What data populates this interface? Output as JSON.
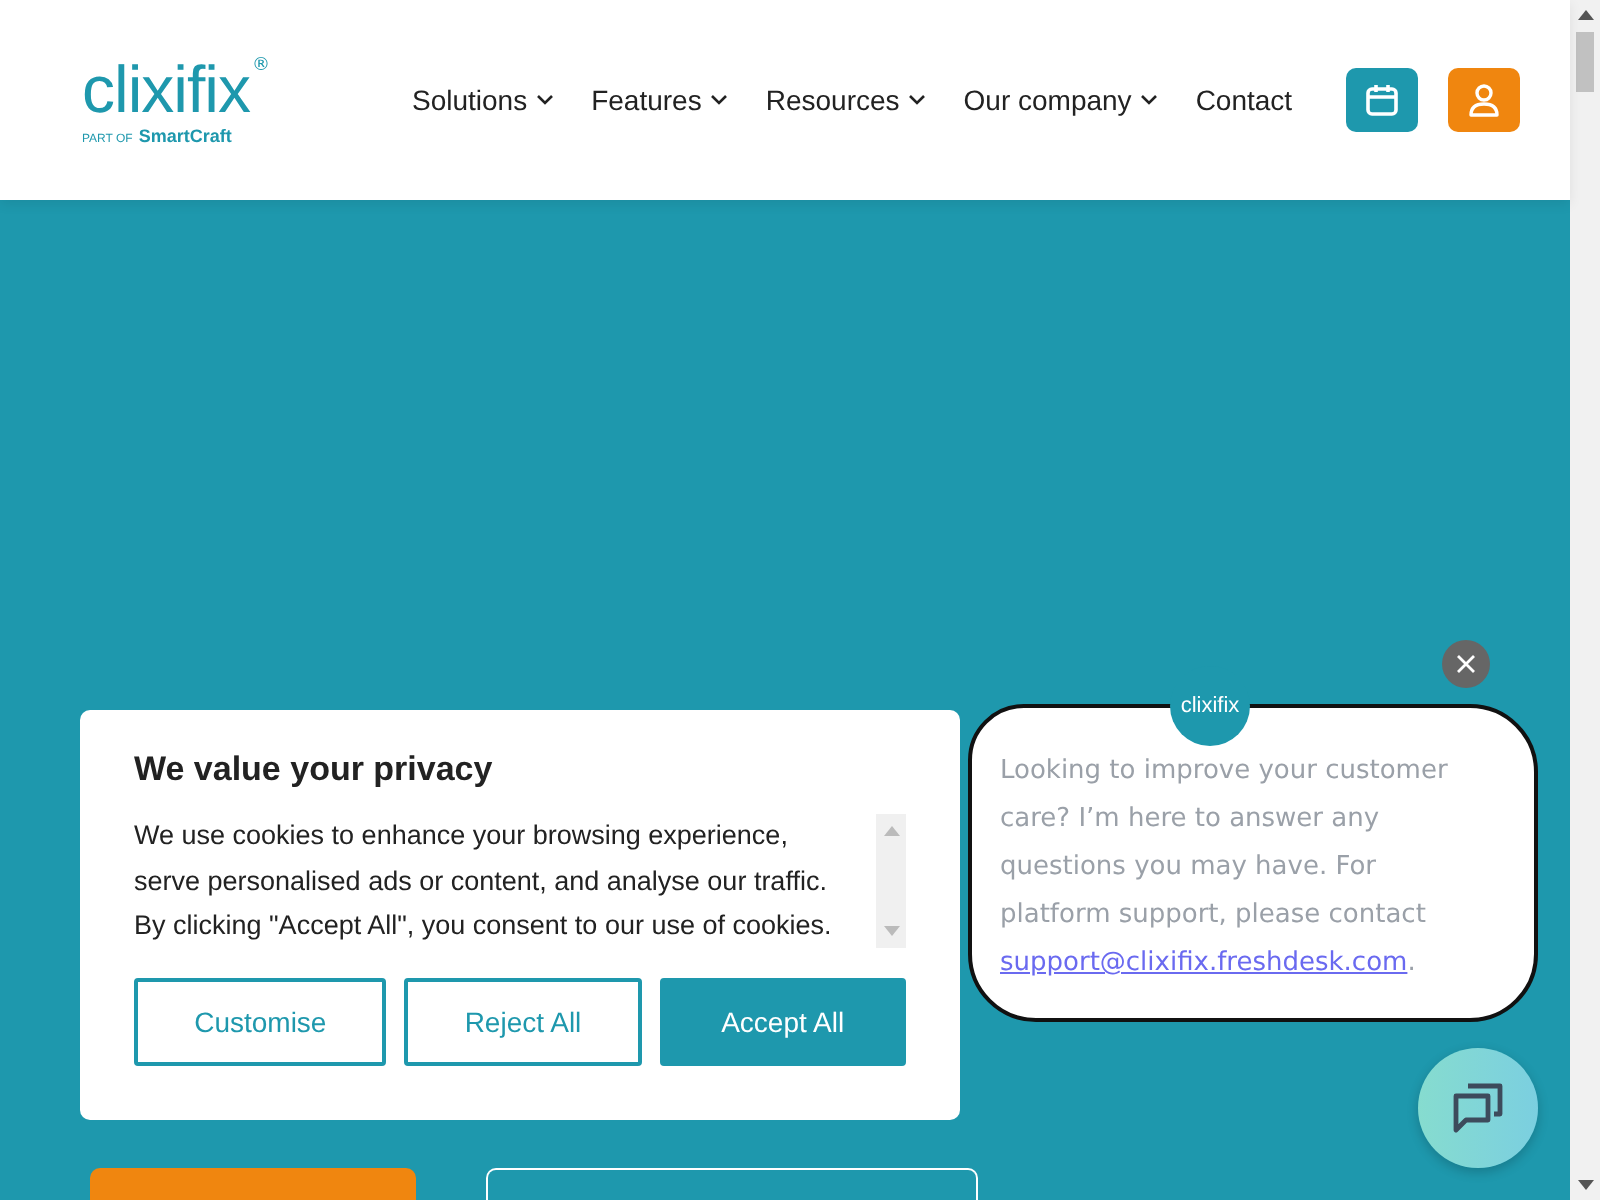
{
  "header": {
    "logo": {
      "name": "clixifix",
      "mark": "®",
      "tagline_prefix": "PART OF",
      "tagline_brand": "SmartCraft"
    },
    "nav": [
      {
        "label": "Solutions",
        "has_dropdown": true
      },
      {
        "label": "Features",
        "has_dropdown": true
      },
      {
        "label": "Resources",
        "has_dropdown": true
      },
      {
        "label": "Our company",
        "has_dropdown": true
      },
      {
        "label": "Contact",
        "has_dropdown": false
      }
    ],
    "actions": [
      {
        "kind": "calendar",
        "color": "#1e98ad"
      },
      {
        "kind": "user",
        "color": "#f0860f"
      }
    ]
  },
  "cookie_banner": {
    "title": "We value your privacy",
    "text": "We use cookies to enhance your browsing experience, serve personalised ads or content, and analyse our traffic. By clicking \"Accept All\", you consent to our use of cookies.",
    "buttons": [
      {
        "label": "Customise",
        "kind": "outline"
      },
      {
        "label": "Reject All",
        "kind": "outline"
      },
      {
        "label": "Accept All",
        "kind": "filled"
      }
    ]
  },
  "chat": {
    "avatar_text": "clixifix",
    "message": "Looking to improve your customer care? I’m here to answer any questions you may have. For platform support, please contact ",
    "email": "support@clixifix.freshdesk.com",
    "message_end": "."
  }
}
